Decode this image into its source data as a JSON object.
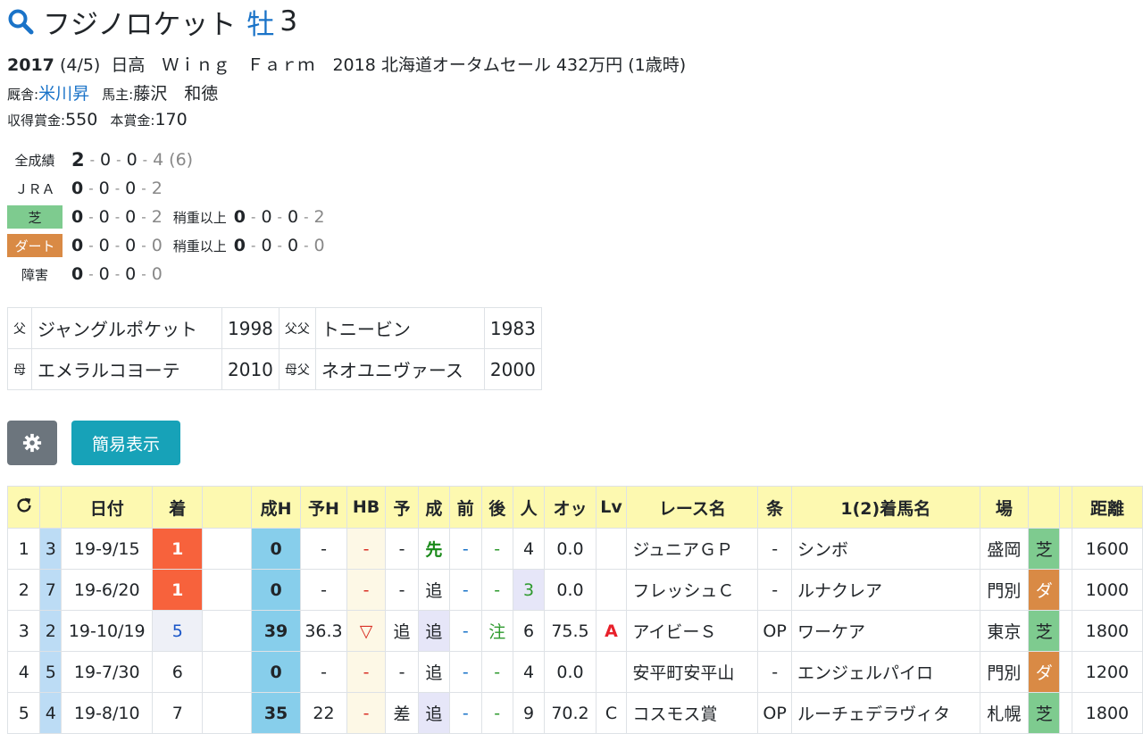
{
  "horse": {
    "name": "フジノロケット",
    "sex": "牡",
    "age": "3",
    "birth_year": "2017",
    "birth_date": "(4/5)",
    "breeder": "日高　Ｗｉｎｇ　Ｆａｒｍ",
    "sale": "2018 北海道オータムセール 432万円 (1歳時)",
    "trainer_label": "厩舎:",
    "trainer": "米川昇",
    "owner_label": "馬主:",
    "owner": "藤沢　和徳",
    "earnings_label": "収得賞金:",
    "earnings": "550",
    "prize_label": "本賞金:",
    "prize": "170"
  },
  "records": [
    {
      "label": "全成績",
      "w": "2",
      "s": "0",
      "t": "0",
      "o": "4",
      "extra": "(6)"
    },
    {
      "label": "ＪＲＡ",
      "w": "0",
      "s": "0",
      "t": "0",
      "o": "2"
    },
    {
      "label": "芝",
      "w": "0",
      "s": "0",
      "t": "0",
      "o": "2",
      "sub_label": "稍重以上",
      "sw": "0",
      "ss": "0",
      "st": "0",
      "so": "2"
    },
    {
      "label": "ダート",
      "w": "0",
      "s": "0",
      "t": "0",
      "o": "0",
      "sub_label": "稍重以上",
      "sw": "0",
      "ss": "0",
      "st": "0",
      "so": "0"
    },
    {
      "label": "障害",
      "w": "0",
      "s": "0",
      "t": "0",
      "o": "0"
    }
  ],
  "pedigree": {
    "sire_label": "父",
    "sire": "ジャングルポケット",
    "sire_year": "1998",
    "sire_sire_label": "父父",
    "sire_sire": "トニービン",
    "sire_sire_year": "1983",
    "dam_label": "母",
    "dam": "エメラルコヨーテ",
    "dam_year": "2010",
    "dam_sire_label": "母父",
    "dam_sire": "ネオユニヴァース",
    "dam_sire_year": "2000"
  },
  "buttons": {
    "simple": "簡易表示"
  },
  "table": {
    "headers": [
      "日付",
      "着",
      "成H",
      "予H",
      "HB",
      "予",
      "成",
      "前",
      "後",
      "人",
      "オッ",
      "Lv",
      "レース名",
      "条",
      "1(2)着馬名",
      "場",
      "距離"
    ],
    "rows": [
      {
        "no": "1",
        "frame": "3",
        "date": "19-9/15",
        "rank": "1",
        "seiH": "0",
        "yoH": "-",
        "hb": "-",
        "yo": "-",
        "sei": "先",
        "mae": "-",
        "ato": "-",
        "pop": "4",
        "odds": "0.0",
        "lv": "",
        "race": "ジュニアＧＰ",
        "cls": "-",
        "winner": "シンボ",
        "venue": "盛岡",
        "surface": "芝",
        "dist": "1600"
      },
      {
        "no": "2",
        "frame": "7",
        "date": "19-6/20",
        "rank": "1",
        "seiH": "0",
        "yoH": "-",
        "hb": "-",
        "yo": "-",
        "sei": "追",
        "mae": "-",
        "ato": "-",
        "pop": "3",
        "odds": "0.0",
        "lv": "",
        "race": "フレッシュＣ",
        "cls": "-",
        "winner": "ルナクレア",
        "venue": "門別",
        "surface": "ダ",
        "dist": "1000"
      },
      {
        "no": "3",
        "frame": "2",
        "date": "19-10/19",
        "rank": "5",
        "seiH": "39",
        "yoH": "36.3",
        "hb": "▽",
        "yo": "追",
        "sei": "追",
        "mae": "-",
        "ato": "注",
        "pop": "6",
        "odds": "75.5",
        "lv": "A",
        "race": "アイビーＳ",
        "cls": "OP",
        "winner": "ワーケア",
        "venue": "東京",
        "surface": "芝",
        "dist": "1800"
      },
      {
        "no": "4",
        "frame": "5",
        "date": "19-7/30",
        "rank": "6",
        "seiH": "0",
        "yoH": "-",
        "hb": "-",
        "yo": "-",
        "sei": "追",
        "mae": "-",
        "ato": "-",
        "pop": "4",
        "odds": "0.0",
        "lv": "",
        "race": "安平町安平山",
        "cls": "-",
        "winner": "エンジェルパイロ",
        "venue": "門別",
        "surface": "ダ",
        "dist": "1200"
      },
      {
        "no": "5",
        "frame": "4",
        "date": "19-8/10",
        "rank": "7",
        "seiH": "35",
        "yoH": "22",
        "hb": "-",
        "yo": "差",
        "sei": "追",
        "mae": "-",
        "ato": "-",
        "pop": "9",
        "odds": "70.2",
        "lv": "C",
        "race": "コスモス賞",
        "cls": "OP",
        "winner": "ルーチェデラヴィタ",
        "venue": "札幌",
        "surface": "芝",
        "dist": "1800"
      }
    ]
  },
  "colors": {
    "link": "#1a73c8",
    "header_bg": "#fdf9b0",
    "win": "#f7623c",
    "turf": "#7ecb8f",
    "dirt": "#d98a45",
    "btn_secondary": "#6c757d",
    "btn_info": "#17a2b8"
  }
}
